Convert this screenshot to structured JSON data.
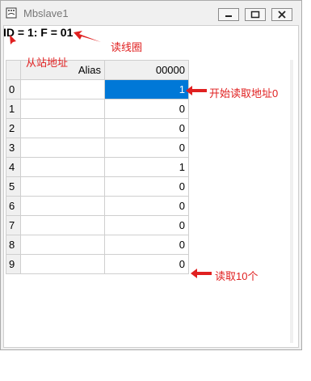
{
  "window": {
    "title": "Mbslave1"
  },
  "header": {
    "status_line": "ID = 1: F = 01"
  },
  "table": {
    "columns": [
      "Alias",
      "00000"
    ],
    "rows": [
      {
        "index": "0",
        "alias": "",
        "value": "1"
      },
      {
        "index": "1",
        "alias": "",
        "value": "0"
      },
      {
        "index": "2",
        "alias": "",
        "value": "0"
      },
      {
        "index": "3",
        "alias": "",
        "value": "0"
      },
      {
        "index": "4",
        "alias": "",
        "value": "1"
      },
      {
        "index": "5",
        "alias": "",
        "value": "0"
      },
      {
        "index": "6",
        "alias": "",
        "value": "0"
      },
      {
        "index": "7",
        "alias": "",
        "value": "0"
      },
      {
        "index": "8",
        "alias": "",
        "value": "0"
      },
      {
        "index": "9",
        "alias": "",
        "value": "0"
      }
    ],
    "selected_row": 0
  },
  "annotations": {
    "read_coils": "读线圈",
    "slave_address": "从站地址",
    "start_read_address": "开始读取地址0",
    "read_ten": "读取10个"
  },
  "colors": {
    "annotation": "#e02020",
    "selection": "#0078d7"
  },
  "icons": {
    "app": "app-icon",
    "min": "minimize-icon",
    "max": "maximize-icon",
    "close": "close-icon"
  }
}
